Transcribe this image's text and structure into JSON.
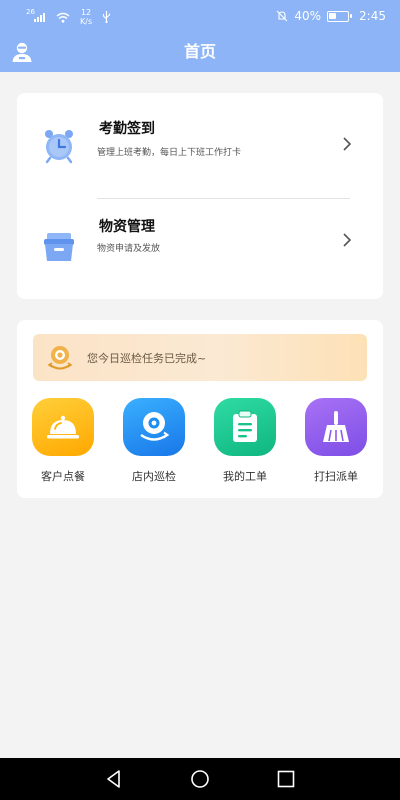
{
  "status_bar": {
    "signal_label": "26",
    "network_speed_value": "12",
    "network_speed_unit": "K/s",
    "battery_percent": "40%",
    "battery_level": 0.4,
    "time": "2:45"
  },
  "header": {
    "title": "首页"
  },
  "menu": [
    {
      "title": "考勤签到",
      "subtitle": "管理上班考勤，每日上下班工作打卡"
    },
    {
      "title": "物资管理",
      "subtitle": "物资申请及发放"
    }
  ],
  "patrol": {
    "banner_text": "您今日巡检任务已完成~",
    "tiles": [
      {
        "label": "客户点餐",
        "icon": "cloche-icon",
        "color": "#ffb300"
      },
      {
        "label": "店内巡检",
        "icon": "camera-icon",
        "color": "#1e8ff0"
      },
      {
        "label": "我的工单",
        "icon": "clipboard-icon",
        "color": "#18c38e"
      },
      {
        "label": "打扫派单",
        "icon": "broom-icon",
        "color": "#8c5cf0"
      }
    ]
  },
  "colors": {
    "header_bg": "#8cb4f6",
    "page_bg": "#f3f3f3"
  }
}
